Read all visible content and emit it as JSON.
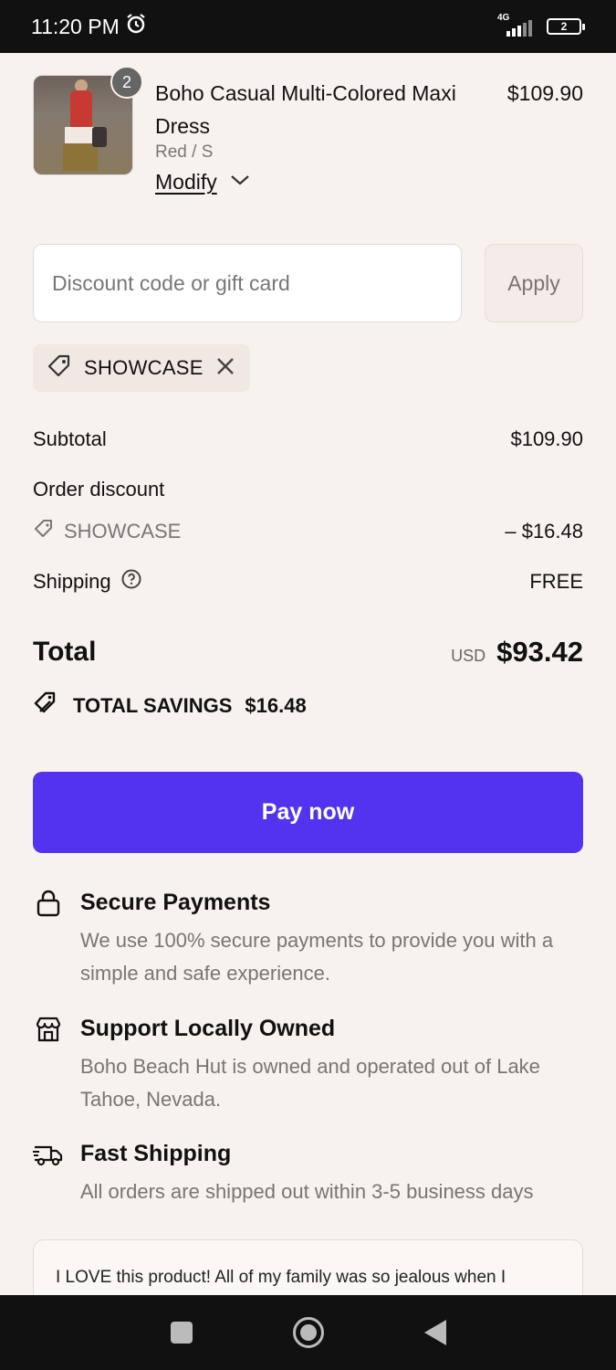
{
  "status_bar": {
    "time": "11:20 PM",
    "network": "4G",
    "battery": "2"
  },
  "product": {
    "name": "Boho Casual Multi-Colored Maxi Dress",
    "variant": "Red / S",
    "price": "$109.90",
    "quantity": "2",
    "modify_label": "Modify"
  },
  "discount": {
    "placeholder": "Discount code or gift card",
    "apply_label": "Apply",
    "applied_code": "SHOWCASE"
  },
  "summary": {
    "subtotal_label": "Subtotal",
    "subtotal_value": "$109.90",
    "order_discount_label": "Order discount",
    "discount_code": "SHOWCASE",
    "discount_value": "– $16.48",
    "shipping_label": "Shipping",
    "shipping_value": "FREE",
    "total_label": "Total",
    "currency": "USD",
    "total_value": "$93.42",
    "savings_label": "TOTAL SAVINGS",
    "savings_value": "$16.48"
  },
  "pay_button": "Pay now",
  "features": [
    {
      "icon": "lock-icon",
      "title": "Secure Payments",
      "description": "We use 100% secure payments to provide you with a simple and safe experience."
    },
    {
      "icon": "store-icon",
      "title": "Support Locally Owned",
      "description": "Boho Beach Hut is owned and operated out of Lake Tahoe, Nevada."
    },
    {
      "icon": "delivery-truck-icon",
      "title": "Fast Shipping",
      "description": "All orders are shipped out within 3-5 business days"
    }
  ],
  "review": {
    "text": "I LOVE this product! All of my family was so jealous when I"
  },
  "colors": {
    "background": "#f8f2ef",
    "accent": "#5433f0",
    "muted_text": "#7a7472"
  }
}
